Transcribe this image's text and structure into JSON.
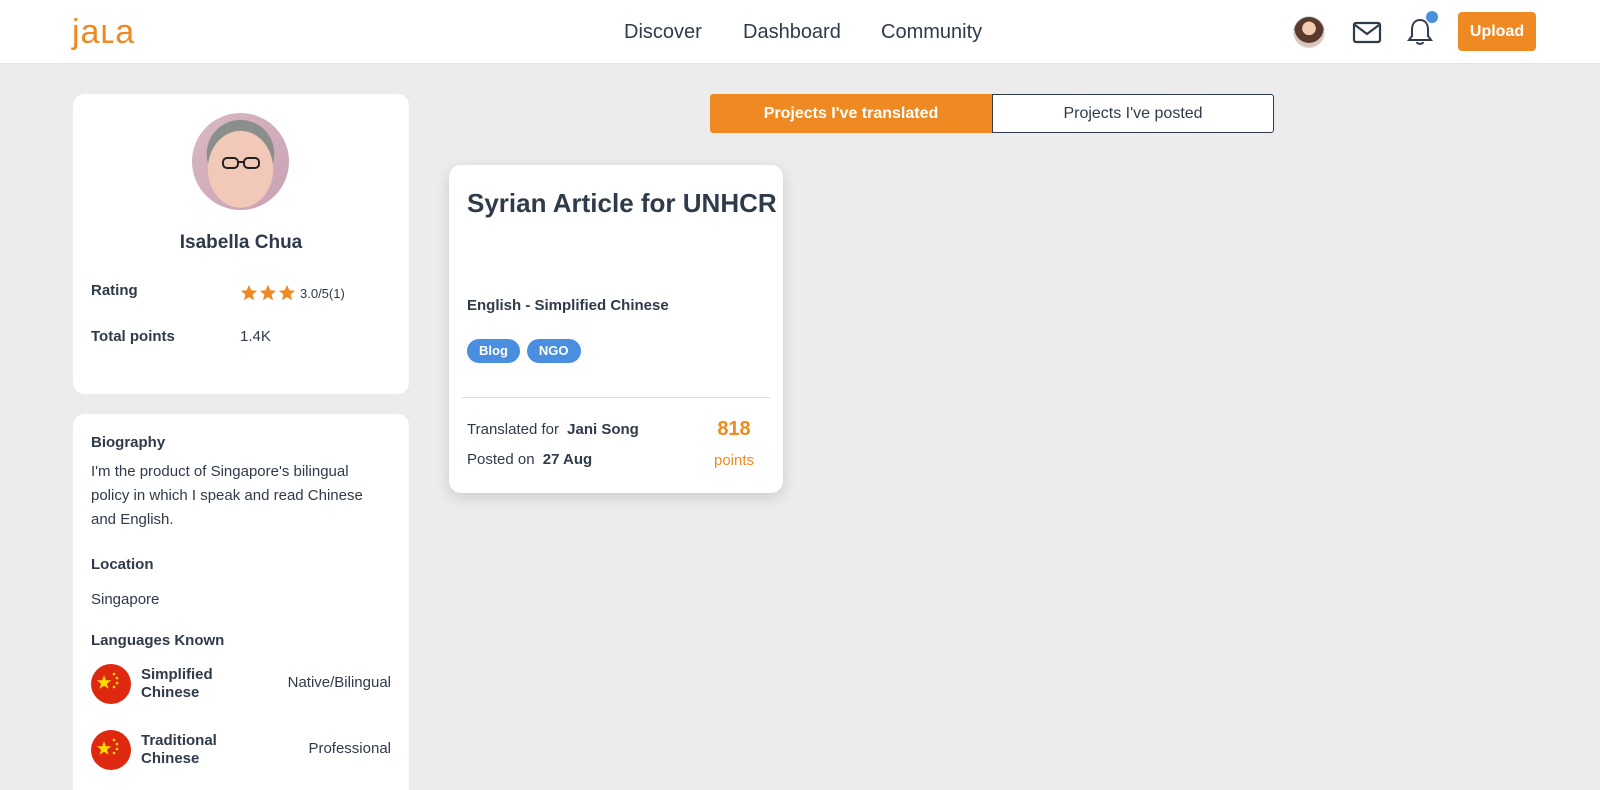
{
  "header": {
    "logo": "jaʟa",
    "nav": [
      "Discover",
      "Dashboard",
      "Community"
    ],
    "upload_label": "Upload"
  },
  "profile": {
    "name": "Isabella Chua",
    "rating_label": "Rating",
    "rating_value": 3.0,
    "rating_text": "3.0/5(1)",
    "points_label": "Total points",
    "points_value": "1.4K"
  },
  "about": {
    "bio_heading": "Biography",
    "bio_text": "I'm the product of Singapore's bilingual policy in which I speak and read Chinese and English.",
    "location_heading": "Location",
    "location_value": "Singapore",
    "languages_heading": "Languages Known",
    "languages": [
      {
        "name": "Simplified Chinese",
        "level": "Native/Bilingual"
      },
      {
        "name": "Traditional Chinese",
        "level": "Professional"
      }
    ]
  },
  "tabs": {
    "translated": "Projects I've translated",
    "posted": "Projects I've posted"
  },
  "project": {
    "title": "Syrian Article for UNHCR",
    "languages": "English - Simplified Chinese",
    "tags": [
      "Blog",
      "NGO"
    ],
    "translated_for_label": "Translated for",
    "translated_for_name": "Jani Song",
    "posted_on_label": "Posted on",
    "posted_on_date": "27 Aug",
    "points": "818",
    "points_label": "points"
  },
  "colors": {
    "accent": "#ef8a22",
    "tag": "#4a8ee0",
    "text": "#2f3a4a",
    "background": "#ececec"
  }
}
